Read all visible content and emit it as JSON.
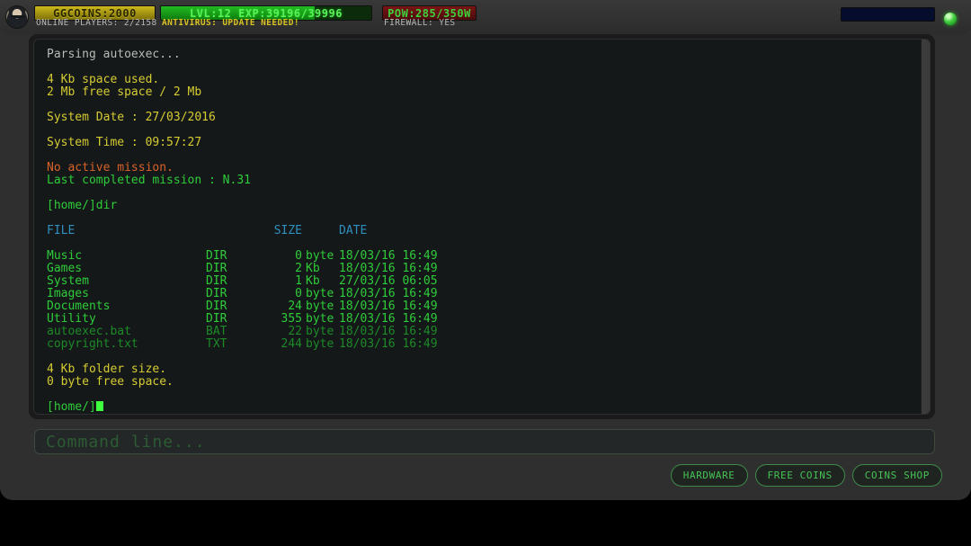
{
  "topbar": {
    "avatar_alt": "player-avatar",
    "coins": {
      "label": "GGCOINS:2000",
      "fill_pct": 100
    },
    "exp": {
      "label": "LVL:12   EXP:39196/39996",
      "fill_pct": 73
    },
    "power": {
      "label": "POW:285/350W",
      "fill_pct": 100
    },
    "online_players": "ONLINE PLAYERS: 2/2158",
    "antivirus": "ANTIVIRUS: UPDATE NEEDED!",
    "firewall": "FIREWALL: YES",
    "colors": {
      "coins": "#cdb81c",
      "exp": "#23bb23",
      "power": "#7a1414",
      "led": "#44d044"
    }
  },
  "terminal": {
    "lines": [
      {
        "text": "Parsing autoexec...",
        "color": "white"
      },
      {
        "text": "",
        "color": "white"
      },
      {
        "text": "4 Kb space used.",
        "color": "yellow"
      },
      {
        "text": "2 Mb free space / 2 Mb",
        "color": "yellow"
      },
      {
        "text": "",
        "color": "white"
      },
      {
        "text": "System Date : 27/03/2016",
        "color": "yellow"
      },
      {
        "text": "",
        "color": "white"
      },
      {
        "text": "System Time : 09:57:27",
        "color": "yellow"
      },
      {
        "text": "",
        "color": "white"
      },
      {
        "text": "No active mission.",
        "color": "orange"
      },
      {
        "text": "Last completed mission : N.31",
        "color": "green"
      },
      {
        "text": "",
        "color": "white"
      },
      {
        "text": "[home/]dir",
        "color": "green"
      }
    ],
    "table": {
      "headers": {
        "file": "FILE",
        "size": "SIZE",
        "date": "DATE"
      },
      "rows": [
        {
          "file": "Music",
          "type": "DIR",
          "size": "0",
          "unit": "byte",
          "date": "18/03/16 16:49",
          "dim": false
        },
        {
          "file": "Games",
          "type": "DIR",
          "size": "2",
          "unit": "Kb",
          "date": "18/03/16 16:49",
          "dim": false
        },
        {
          "file": "System",
          "type": "DIR",
          "size": "1",
          "unit": "Kb",
          "date": "27/03/16 06:05",
          "dim": false
        },
        {
          "file": "Images",
          "type": "DIR",
          "size": "0",
          "unit": "byte",
          "date": "18/03/16 16:49",
          "dim": false
        },
        {
          "file": "Documents",
          "type": "DIR",
          "size": "24",
          "unit": "byte",
          "date": "18/03/16 16:49",
          "dim": false
        },
        {
          "file": "Utility",
          "type": "DIR",
          "size": "355",
          "unit": "byte",
          "date": "18/03/16 16:49",
          "dim": false
        },
        {
          "file": "autoexec.bat",
          "type": "BAT",
          "size": "22",
          "unit": "byte",
          "date": "18/03/16 16:49",
          "dim": true
        },
        {
          "file": "copyright.txt",
          "type": "TXT",
          "size": "244",
          "unit": "byte",
          "date": "18/03/16 16:49",
          "dim": true
        }
      ]
    },
    "footer": [
      {
        "text": "4 Kb folder size.",
        "color": "yellow"
      },
      {
        "text": "0 byte free space.",
        "color": "yellow"
      }
    ],
    "prompt": "[home/]"
  },
  "command_line": {
    "value": "",
    "placeholder": "Command line..."
  },
  "buttons": [
    {
      "label": "HARDWARE",
      "name": "hardware-button"
    },
    {
      "label": "FREE COINS",
      "name": "free-coins-button"
    },
    {
      "label": "COINS SHOP",
      "name": "coins-shop-button"
    }
  ]
}
